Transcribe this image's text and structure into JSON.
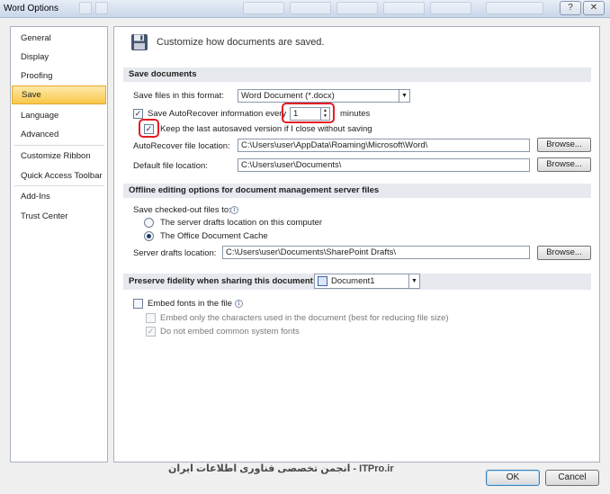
{
  "window": {
    "title": "Word Options"
  },
  "sidebar": {
    "items": [
      {
        "label": "General"
      },
      {
        "label": "Display"
      },
      {
        "label": "Proofing"
      },
      {
        "label": "Save"
      },
      {
        "label": "Language"
      },
      {
        "label": "Advanced"
      },
      {
        "label": "Customize Ribbon"
      },
      {
        "label": "Quick Access Toolbar"
      },
      {
        "label": "Add-Ins"
      },
      {
        "label": "Trust Center"
      }
    ],
    "active": "Save"
  },
  "header": {
    "text": "Customize how documents are saved.",
    "icon": "floppy-disk-icon"
  },
  "save_documents": {
    "heading": "Save documents",
    "format_label": "Save files in this format:",
    "format_value": "Word Document (*.docx)",
    "autorecover_label": "Save AutoRecover information every",
    "autorecover_value": "1",
    "minutes_label": "minutes",
    "keep_last_label": "Keep the last autosaved version if I close without saving",
    "autorecover_location_label": "AutoRecover file location:",
    "autorecover_location_value": "C:\\Users\\user\\AppData\\Roaming\\Microsoft\\Word\\",
    "default_location_label": "Default file location:",
    "default_location_value": "C:\\Users\\user\\Documents\\",
    "browse_label": "Browse..."
  },
  "offline": {
    "heading": "Offline editing options for document management server files",
    "checked_out_label": "Save checked-out files to:",
    "server_drafts_option": "The server drafts location on this computer",
    "office_cache_option": "The Office Document Cache",
    "server_drafts_label": "Server drafts location:",
    "server_drafts_value": "C:\\Users\\user\\Documents\\SharePoint Drafts\\",
    "browse_label": "Browse..."
  },
  "fidelity": {
    "heading": "Preserve fidelity when sharing this document:",
    "document_value": "Document1",
    "embed_fonts_label": "Embed fonts in the file",
    "embed_chars_label": "Embed only the characters used in the document (best for reducing file size)",
    "no_common_fonts_label": "Do not embed common system fonts"
  },
  "footer": {
    "watermark": "انجمن تخصصی فناوری اطلاعات ایران - ITPro.ir",
    "ok_label": "OK",
    "cancel_label": "Cancel"
  },
  "colors": {
    "annotation": "#e51b24",
    "active_item": "#f8c84a"
  }
}
